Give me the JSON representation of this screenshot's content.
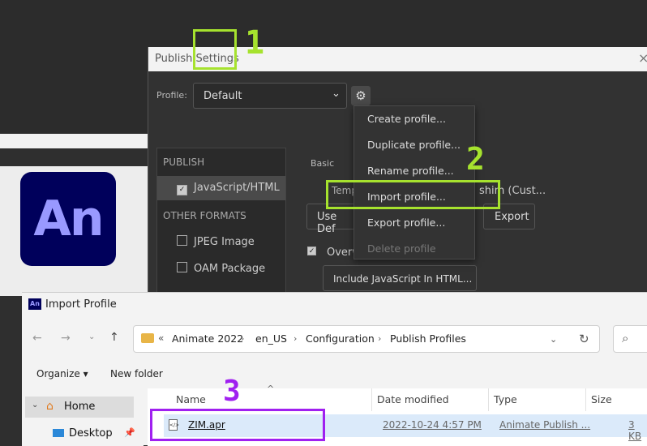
{
  "publish_settings": {
    "title": "Publish Settings",
    "close_glyph": "×",
    "profile_label": "Profile:",
    "profile_value": "Default",
    "sidebar": {
      "publish_header": "PUBLISH",
      "javascript_html": "JavaScript/HTML",
      "other_formats_header": "OTHER FORMATS",
      "jpeg_image": "JPEG Image",
      "oam_package": "OAM Package"
    },
    "basic_label": "Basic",
    "template_label": "Temp",
    "shim_label": "shim (Cust...",
    "use_default_label": "Use Def",
    "export_label": "Export",
    "overwrite_label": "Overw",
    "include_js_label": "Include JavaScript In HTML..."
  },
  "profile_menu": {
    "items": [
      {
        "label": "Create profile...",
        "enabled": true
      },
      {
        "label": "Duplicate profile...",
        "enabled": true
      },
      {
        "label": "Rename profile...",
        "enabled": true
      },
      {
        "label": "Import  profile...",
        "enabled": true
      },
      {
        "label": "Export profile...",
        "enabled": true
      },
      {
        "label": "Delete profile",
        "enabled": false
      }
    ]
  },
  "annotations": {
    "step1": "1",
    "step2": "2",
    "step3": "3",
    "color_step12": "#a6e22e",
    "color_step3": "#a020f0"
  },
  "logo_text": "An",
  "import_dialog": {
    "icon_text": "An",
    "title": "Import Profile",
    "breadcrumb": [
      "Animate 2022",
      "en_US",
      "Configuration",
      "Publish Profiles"
    ],
    "overflow": "«",
    "toolbar": {
      "organize": "Organize ▾",
      "new_folder": "New folder"
    },
    "tree": {
      "home": "Home",
      "desktop": "Desktop"
    },
    "columns": {
      "name": "Name",
      "date": "Date modified",
      "type": "Type",
      "size": "Size"
    },
    "files": [
      {
        "name": "ZIM.apr",
        "date": "2022-10-24 4:57 PM",
        "type": "Animate Publish ...",
        "size": "3 KB"
      }
    ]
  }
}
